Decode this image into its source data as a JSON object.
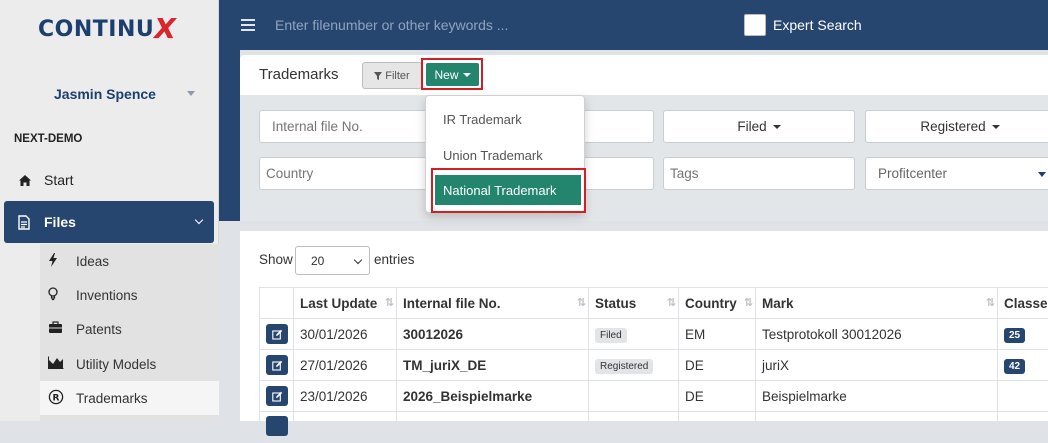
{
  "sidebar": {
    "logo_main": "CONTINU",
    "logo_x": "X",
    "user_name": "Jasmin Spence",
    "section": "NEXT-DEMO",
    "start": "Start",
    "files": "Files",
    "items": [
      {
        "label": "Ideas",
        "icon": "bolt-icon"
      },
      {
        "label": "Inventions",
        "icon": "lightbulb-icon"
      },
      {
        "label": "Patents",
        "icon": "briefcase-icon"
      },
      {
        "label": "Utility Models",
        "icon": "chart-icon"
      },
      {
        "label": "Trademarks",
        "icon": "registered-icon"
      }
    ]
  },
  "topbar": {
    "search_placeholder": "Enter filenumber or other keywords ...",
    "expert_search": "Expert Search"
  },
  "header": {
    "title": "Trademarks",
    "filter_label": "Filter",
    "new_label": "New"
  },
  "new_menu": {
    "items": [
      "IR Trademark",
      "Union Trademark",
      "National Trademark"
    ]
  },
  "filters": {
    "internal_file_placeholder": "Internal file No.",
    "filed_label": "Filed",
    "registered_label": "Registered",
    "country_placeholder": "Country",
    "tags_placeholder": "Tags",
    "profitcenter_placeholder": "Profitcenter"
  },
  "table": {
    "show_label": "Show",
    "entries_value": "20",
    "entries_label": "entries",
    "columns": [
      "",
      "Last Update",
      "Internal file No.",
      "Status",
      "Country",
      "Mark",
      "Classes"
    ],
    "rows": [
      {
        "date": "30/01/2026",
        "file": "30012026",
        "status": "Filed",
        "country": "EM",
        "mark": "Testprotokoll 30012026",
        "classes": "25"
      },
      {
        "date": "27/01/2026",
        "file": "TM_juriX_DE",
        "status": "Registered",
        "country": "DE",
        "mark": "juriX",
        "classes": "42"
      },
      {
        "date": "23/01/2026",
        "file": "2026_Beispielmarke",
        "status": "",
        "country": "DE",
        "mark": "Beispielmarke",
        "classes": ""
      }
    ]
  },
  "colors": {
    "navy": "#27466f",
    "green": "#24856f",
    "highlight": "#d12025"
  }
}
